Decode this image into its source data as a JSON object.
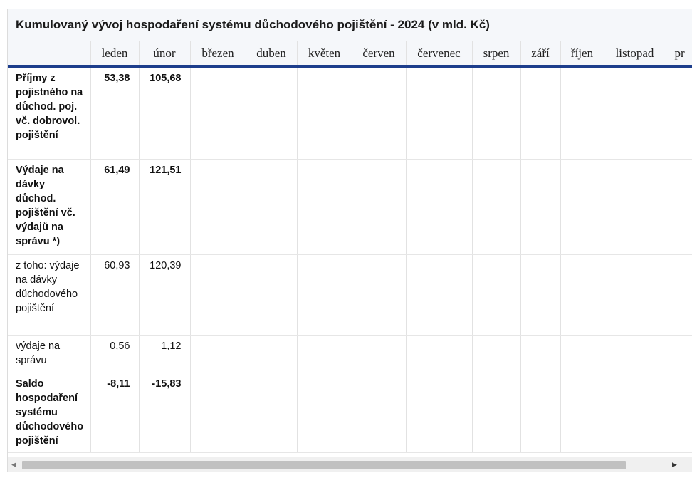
{
  "caption": "Kumulovaný vývoj hospodaření systému důchodového pojištění - 2024 (v mld. Kč)",
  "columns": [
    "",
    "leden",
    "únor",
    "březen",
    "duben",
    "květen",
    "červen",
    "červenec",
    "srpen",
    "září",
    "říjen",
    "listopad",
    "pr"
  ],
  "rows": [
    {
      "label": "Příjmy z pojistného na důchod. poj. vč. dobrovol. pojištění",
      "bold": true,
      "values": [
        "53,38",
        "105,68"
      ]
    },
    {
      "label": "Výdaje na dávky důchod. pojištění vč. výdajů na správu *)",
      "bold": true,
      "values": [
        "61,49",
        "121,51"
      ]
    },
    {
      "label": "z toho: výdaje na dávky důchodového pojištění",
      "bold": false,
      "values": [
        "60,93",
        "120,39"
      ]
    },
    {
      "label": "výdaje na správu",
      "bold": false,
      "values": [
        "0,56",
        "1,12"
      ]
    },
    {
      "label": "Saldo hospodaření systému důchodového pojištění",
      "bold": true,
      "values": [
        "-8,11",
        "-15,83"
      ]
    }
  ],
  "scrollbar": {
    "left_arrow": "◀",
    "right_arrow": "▶"
  }
}
